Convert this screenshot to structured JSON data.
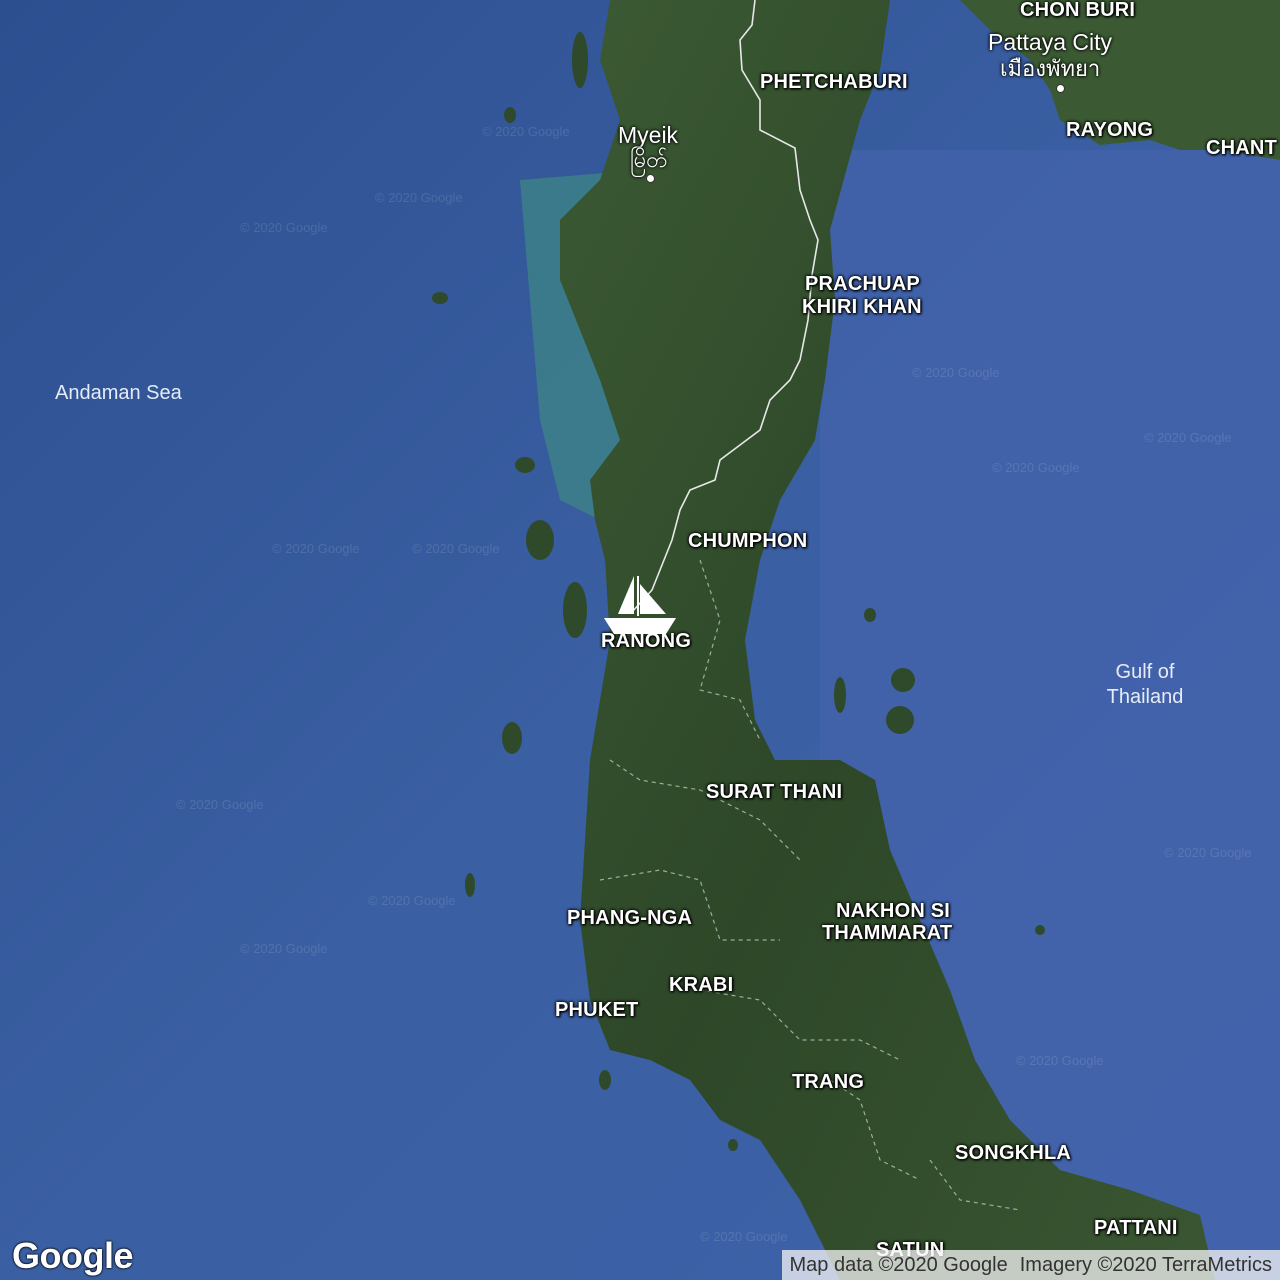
{
  "map": {
    "water_labels": {
      "andaman": "Andaman Sea",
      "gulf_line1": "Gulf of",
      "gulf_line2": "Thailand"
    },
    "cities": {
      "mveik_en": "Myeik",
      "mveik_my": "မြိတ်",
      "pattaya_en": "Pattaya City",
      "pattaya_th": "เมืองพัทยา"
    },
    "provinces": {
      "chon_buri": "CHON BURI",
      "phetchaburi": "PHETCHABURI",
      "rayong": "RAYONG",
      "chanthaburi": "CHANT",
      "prachuap_line1": "PRACHUAP",
      "prachuap_line2": "KHIRI KHAN",
      "chumphon": "CHUMPHON",
      "ranong": "RANONG",
      "surat_thani": "SURAT THANI",
      "phang_nga": "PHANG-NGA",
      "nakhon_line1": "NAKHON SI",
      "nakhon_line2": "THAMMARAT",
      "krabi": "KRABI",
      "phuket": "PHUKET",
      "trang": "TRANG",
      "songkhla": "SONGKHLA",
      "pattani": "PATTANI",
      "satun": "SATUN"
    },
    "marker": {
      "icon": "sailboat-icon"
    },
    "watermark": "© 2020 Google",
    "logo": "Google",
    "attribution": {
      "map_data": "Map data ©2020 Google",
      "imagery": "Imagery ©2020 TerraMetrics"
    },
    "colors": {
      "sea": "#3b5fa0",
      "sea_deep": "#2f4f8f",
      "land": "#2f4a2a",
      "land_light": "#4a6a3c",
      "shallow": "#3f8a8a",
      "border": "#e8e8e8"
    }
  }
}
